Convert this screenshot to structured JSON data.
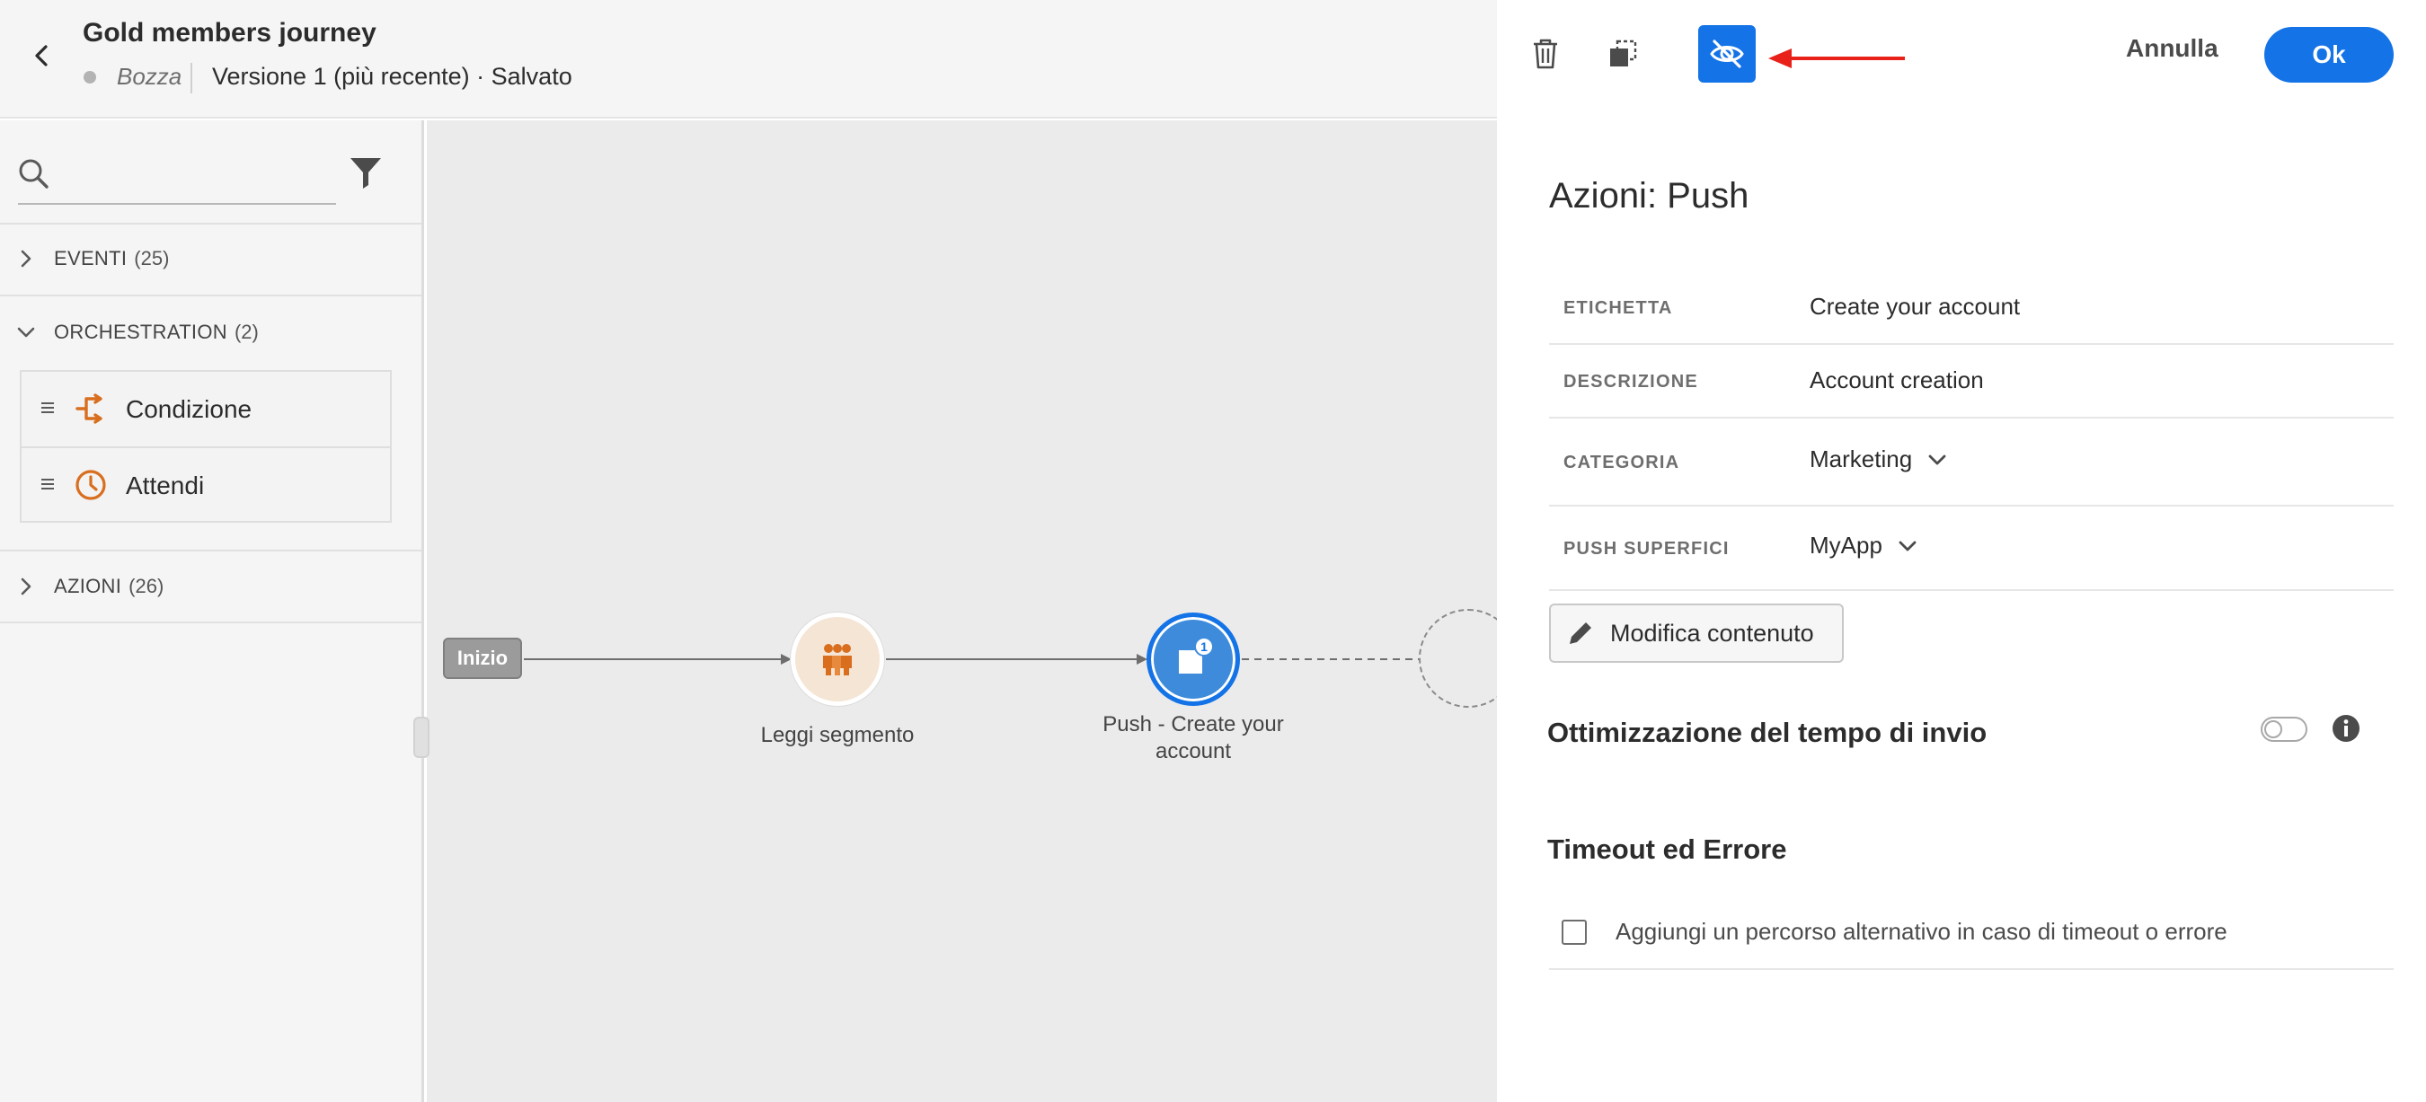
{
  "header": {
    "title": "Gold members journey",
    "status": "Bozza",
    "version": "Versione 1 (più recente) · Salvato"
  },
  "palette": {
    "search": {
      "placeholder": "",
      "value": ""
    },
    "sections": [
      {
        "label": "EVENTI",
        "count": "(25)",
        "expanded": false
      },
      {
        "label": "ORCHESTRATION",
        "count": "(2)",
        "expanded": true
      },
      {
        "label": "AZIONI",
        "count": "(26)",
        "expanded": false
      }
    ],
    "orchestration_items": [
      {
        "label": "Condizione",
        "icon": "condition-icon"
      },
      {
        "label": "Attendi",
        "icon": "clock-icon"
      }
    ]
  },
  "canvas": {
    "start_label": "Inizio",
    "nodes": [
      {
        "label": "Leggi segmento",
        "icon": "segment-icon",
        "color": "#f5e5d5"
      },
      {
        "label_line1": "Push - Create your",
        "label_line2": "account",
        "icon": "push-icon",
        "badge": "1",
        "color": "#1473e6"
      }
    ]
  },
  "panel": {
    "toolbar": {
      "delete_icon": "trash-icon",
      "duplicate_icon": "duplicate-icon",
      "hide_icon": "eye-off-icon",
      "cancel_label": "Annulla",
      "ok_label": "Ok"
    },
    "title": "Azioni: Push",
    "fields": [
      {
        "label": "ETICHETTA",
        "value": "Create your account"
      },
      {
        "label": "DESCRIZIONE",
        "value": "Account creation"
      },
      {
        "label": "CATEGORIA",
        "value": "Marketing"
      },
      {
        "label": "PUSH SUPERFICI",
        "value": "MyApp"
      }
    ],
    "edit_content_label": "Modifica contenuto",
    "send_time_optimization": {
      "title": "Ottimizzazione del tempo di invio",
      "enabled": false
    },
    "timeout": {
      "title": "Timeout ed Errore",
      "alt_path_label": "Aggiungi un percorso alternativo in caso di timeout o errore",
      "checked": false
    }
  },
  "colors": {
    "accent": "#1473e6",
    "annotation_arrow": "#e8221a",
    "orange_icon": "#d86e1e"
  }
}
